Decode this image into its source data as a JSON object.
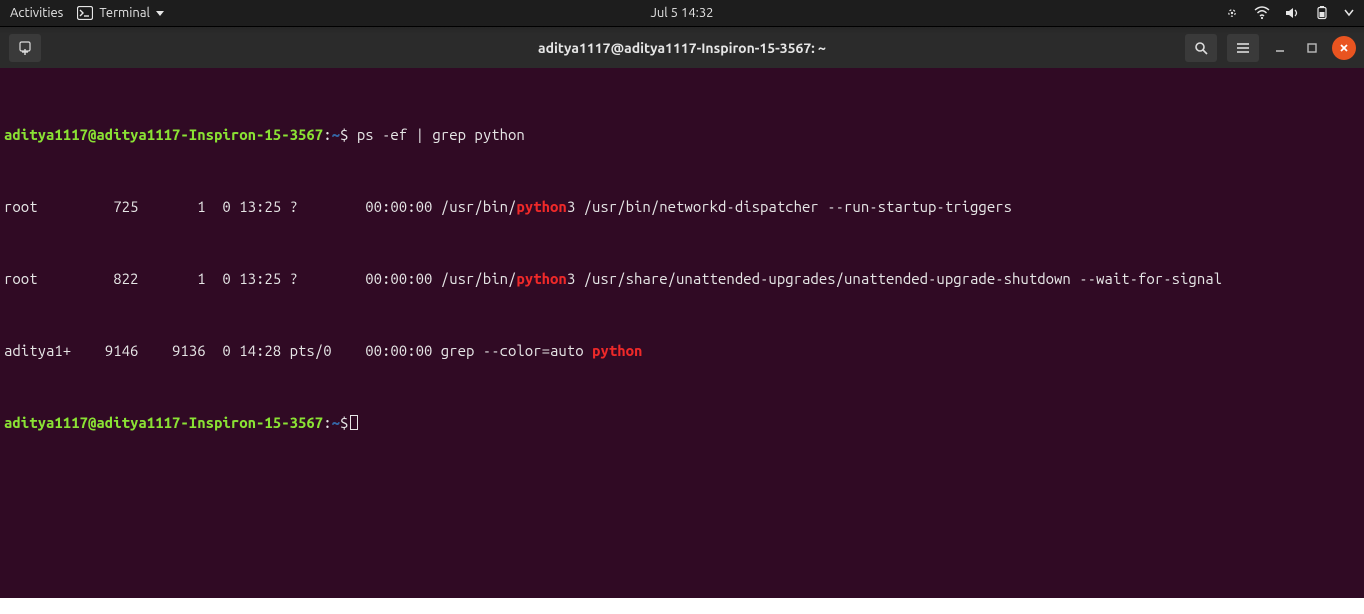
{
  "topbar": {
    "activities": "Activities",
    "app_name": "Terminal",
    "clock": "Jul 5  14:32"
  },
  "window": {
    "title": "aditya1117@aditya1117-Inspiron-15-3567: ~"
  },
  "terminal": {
    "prompt": {
      "user_host": "aditya1117@aditya1117-Inspiron-15-3567",
      "sep": ":",
      "cwd": "~",
      "sigil": "$"
    },
    "command": "ps -ef | grep python",
    "lines": [
      {
        "pre": "root         725       1  0 13:25 ?        00:00:00 /usr/bin/",
        "match": "python",
        "post": "3 /usr/bin/networkd-dispatcher --run-startup-triggers"
      },
      {
        "pre": "root         822       1  0 13:25 ?        00:00:00 /usr/bin/",
        "match": "python",
        "post": "3 /usr/share/unattended-upgrades/unattended-upgrade-shutdown --wait-for-signal"
      },
      {
        "pre": "aditya1+    9146    9136  0 14:28 pts/0    00:00:00 grep --color=auto ",
        "match": "python",
        "post": ""
      }
    ]
  }
}
